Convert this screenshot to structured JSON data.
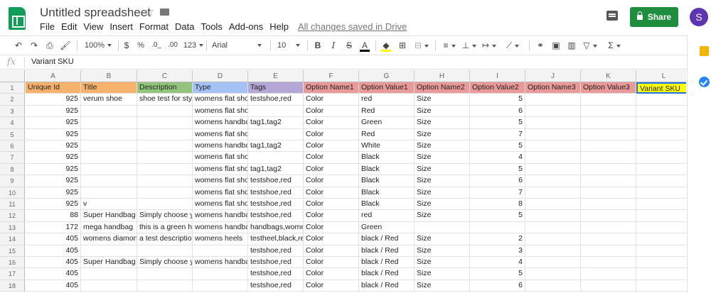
{
  "app": {
    "doc_title": "Untitled spreadsheet",
    "saved_status": "All changes saved in Drive",
    "share_label": "Share",
    "avatar_initial": "S",
    "accent": "#1e8e3e"
  },
  "menu": [
    "File",
    "Edit",
    "View",
    "Insert",
    "Format",
    "Data",
    "Tools",
    "Add-ons",
    "Help"
  ],
  "toolbar": {
    "zoom": "100%",
    "currency": "$",
    "percent": "%",
    "decimal_decrease": ".0_",
    "decimal_increase": ".00",
    "format_more": "123",
    "font": "Arial",
    "font_size": "10",
    "bold": "B",
    "italic": "I",
    "strikethrough": "S",
    "text_color": "A",
    "function": "Σ"
  },
  "formula_bar": {
    "fx": "fx",
    "value": "Variant SKU"
  },
  "sheet": {
    "column_letters": [
      "A",
      "B",
      "C",
      "D",
      "E",
      "F",
      "G",
      "H",
      "I",
      "J",
      "K",
      "L"
    ],
    "row_numbers": [
      "1",
      "2",
      "3",
      "4",
      "5",
      "6",
      "7",
      "8",
      "9",
      "10",
      "11",
      "12",
      "13",
      "14",
      "15",
      "16",
      "17",
      "18"
    ],
    "header_colors": [
      "#f6b26b",
      "#f6b26b",
      "#93c47d",
      "#a4c2f4",
      "#b4a7d6",
      "#ea9999",
      "#ea9999",
      "#ea9999",
      "#ea9999",
      "#ea9999",
      "#ea9999",
      "#ffff00"
    ],
    "rows": [
      [
        "Unique Id",
        "Title",
        "Description",
        "Type",
        "Tags",
        "Option Name1",
        "Option Value1",
        "Option Name2",
        "Option Value2",
        "Option Name3",
        "Option Value3",
        "Variant SKU"
      ],
      [
        "925",
        "verum shoe",
        "shoe test for stycl",
        "womens flat shoe",
        "testshoe,red",
        "Color",
        "red",
        "Size",
        "5",
        "",
        "",
        ""
      ],
      [
        "925",
        "",
        "",
        "womens flat shoes and sandals",
        "",
        "Color",
        "Red",
        "Size",
        "6",
        "",
        "",
        ""
      ],
      [
        "925",
        "",
        "",
        "womens handbag",
        "tag1,tag2",
        "Color",
        "Green",
        "Size",
        "5",
        "",
        "",
        ""
      ],
      [
        "925",
        "",
        "",
        "womens flat shoes and sandals",
        "",
        "Color",
        "Red",
        "Size",
        "7",
        "",
        "",
        ""
      ],
      [
        "925",
        "",
        "",
        "womens handba",
        "tag1,tag2",
        "Color",
        "White",
        "Size",
        "5",
        "",
        "",
        ""
      ],
      [
        "925",
        "",
        "",
        "womens flat shoes and sandals",
        "",
        "Color",
        "Black",
        "Size",
        "4",
        "",
        "",
        ""
      ],
      [
        "925",
        "",
        "",
        "womens flat shoe",
        "tag1,tag2",
        "Color",
        "Black",
        "Size",
        "5",
        "",
        "",
        ""
      ],
      [
        "925",
        "",
        "",
        "womens flat shoe",
        "testshoe,red",
        "Color",
        "Black",
        "Size",
        "6",
        "",
        "",
        ""
      ],
      [
        "925",
        "",
        "",
        "womens flat shoe",
        "testshoe,red",
        "Color",
        "Black",
        "Size",
        "7",
        "",
        "",
        ""
      ],
      [
        "925",
        "v",
        "",
        "womens flat shoe",
        "testshoe,red",
        "Color",
        "Black",
        "Size",
        "8",
        "",
        "",
        ""
      ],
      [
        "88",
        "Super Handbag",
        "Simply choose yo",
        "womens handbag",
        "testshoe,red",
        "Color",
        "red",
        "Size",
        "5",
        "",
        "",
        ""
      ],
      [
        "172",
        "mega handbag",
        "this is a green ha",
        "womens handbag",
        "handbags,wome",
        "Color",
        "Green",
        "",
        "",
        "",
        "",
        ""
      ],
      [
        "405",
        "womens diamond",
        "a test description",
        "womens heels",
        "testheel,black,re",
        "Color",
        "black / Red",
        "Size",
        "2",
        "",
        "",
        ""
      ],
      [
        "405",
        "",
        "",
        "",
        "testshoe,red",
        "Color",
        "black / Red",
        "Size",
        "3",
        "",
        "",
        ""
      ],
      [
        "405",
        "Super Handbag",
        "Simply choose yo",
        "womens handbag",
        "testshoe,red",
        "Color",
        "black / Red",
        "Size",
        "4",
        "",
        "",
        ""
      ],
      [
        "405",
        "",
        "",
        "",
        "testshoe,red",
        "Color",
        "black / Red",
        "Size",
        "5",
        "",
        "",
        ""
      ],
      [
        "405",
        "",
        "",
        "",
        "testshoe,red",
        "Color",
        "black / Red",
        "Size",
        "6",
        "",
        "",
        ""
      ]
    ]
  }
}
